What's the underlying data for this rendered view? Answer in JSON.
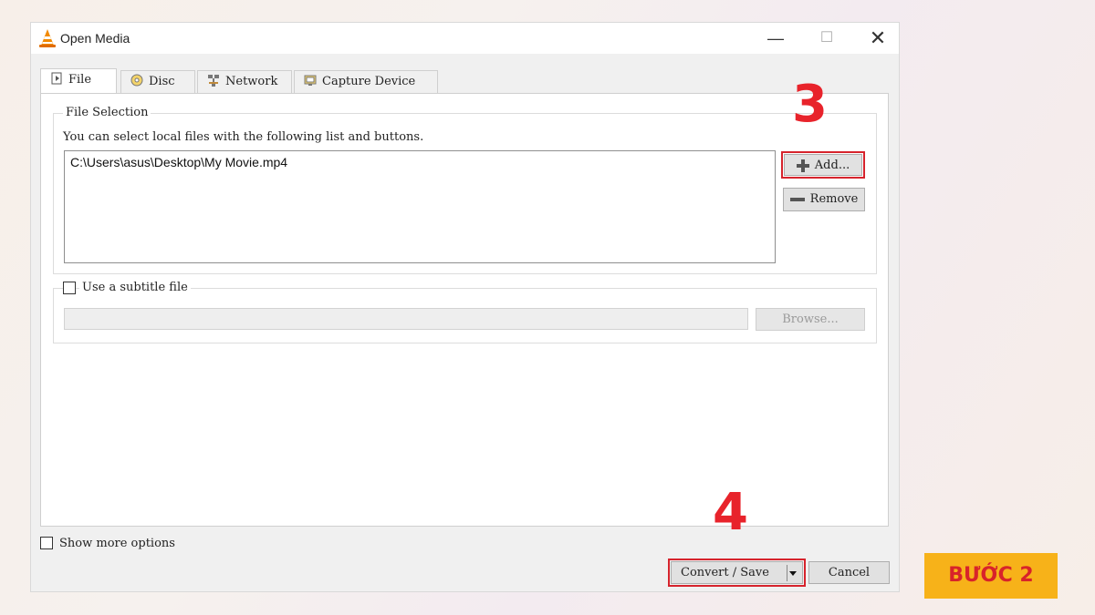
{
  "window": {
    "title": "Open Media",
    "minimize": "—",
    "maximize": "☐",
    "close": "✕"
  },
  "tabs": [
    {
      "label": "File",
      "icon": "file-icon"
    },
    {
      "label": "Disc",
      "icon": "disc-icon"
    },
    {
      "label": "Network",
      "icon": "network-icon"
    },
    {
      "label": "Capture Device",
      "icon": "capture-device-icon"
    }
  ],
  "file_selection": {
    "group_label": "File Selection",
    "hint": "You can select local files with the following list and buttons.",
    "files": [
      "C:\\Users\\asus\\Desktop\\My Movie.mp4"
    ],
    "add_label": "Add...",
    "remove_label": "Remove"
  },
  "subtitle": {
    "checkbox_label": "Use a subtitle file",
    "checked": false,
    "path_value": "",
    "browse_label": "Browse..."
  },
  "footer": {
    "show_more_label": "Show more options",
    "convert_label": "Convert / Save",
    "cancel_label": "Cancel"
  },
  "annotations": {
    "step3": "3",
    "step4": "4",
    "badge": "BƯỚC 2",
    "highlight_color": "#d6232c",
    "badge_color": "#f7b219"
  }
}
